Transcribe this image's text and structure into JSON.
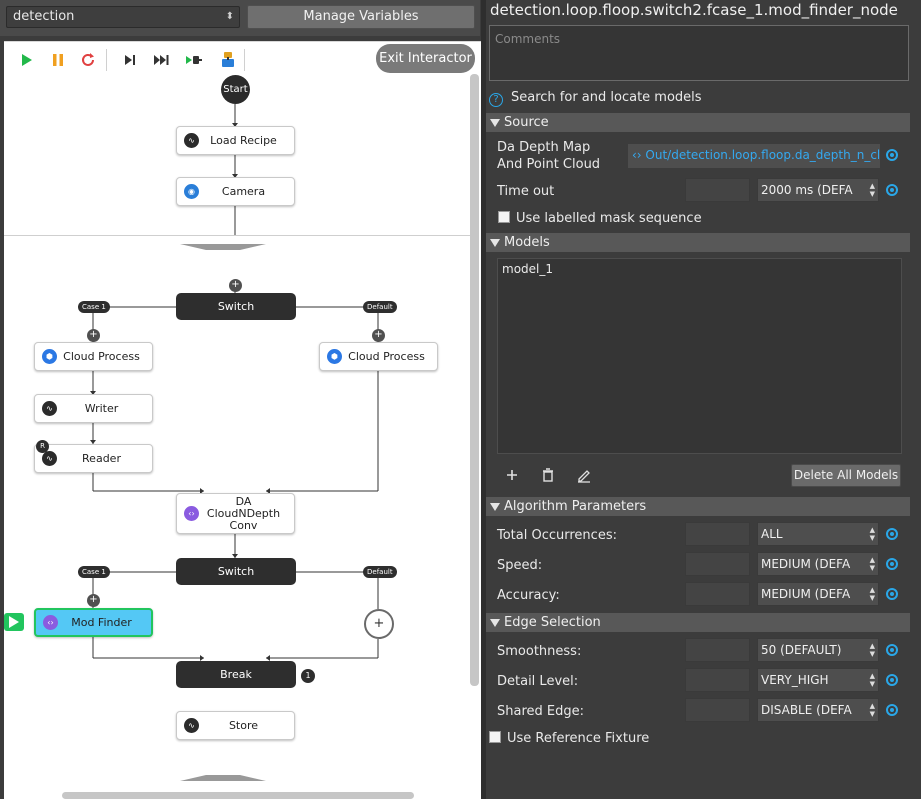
{
  "flow_selector": {
    "value": "detection"
  },
  "toolbar": {
    "manage_variables": "Manage Variables",
    "exit_interactor": "Exit Interactor"
  },
  "flow": {
    "start": "Start",
    "nodes": {
      "load_recipe": "Load Recipe",
      "camera": "Camera",
      "switch1": "Switch",
      "cloud_process_left": "Cloud Process",
      "cloud_process_right": "Cloud Process",
      "writer": "Writer",
      "reader": "Reader",
      "reader_badge": "R",
      "da_cloud_line1": "DA CloudNDepth",
      "da_cloud_line2": "Conv",
      "switch2": "Switch",
      "mod_finder": "Mod Finder",
      "break": "Break",
      "break_badge": "1",
      "store": "Store"
    },
    "tags": {
      "case1_a": "Case 1",
      "default_a": "Default",
      "case1_b": "Case 1",
      "default_b": "Default"
    },
    "plus": "+"
  },
  "panel": {
    "title": "detection.loop.floop.switch2.fcase_1.mod_finder_node",
    "comments_placeholder": "Comments",
    "help_text": "Search for and locate models",
    "sections": {
      "source": "Source",
      "models": "Models",
      "algorithm": "Algorithm Parameters",
      "edge": "Edge Selection"
    },
    "source": {
      "da_label_1": "Da Depth Map",
      "da_label_2": "And Point Cloud",
      "da_value": "Out/detection.loop.floop.da_depth_n_clo",
      "timeout_label": "Time out",
      "timeout_value": "2000 ms (DEFA",
      "labelled_mask": "Use labelled mask sequence"
    },
    "models": {
      "items": [
        "model_1"
      ],
      "delete_all": "Delete All Models"
    },
    "algorithm": {
      "total_occ_label": "Total Occurrences:",
      "total_occ_value": "ALL",
      "speed_label": "Speed:",
      "speed_value": "MEDIUM (DEFA",
      "accuracy_label": "Accuracy:",
      "accuracy_value": "MEDIUM (DEFA"
    },
    "edge": {
      "smoothness_label": "Smoothness:",
      "smoothness_value": "50 (DEFAULT)",
      "detail_label": "Detail Level:",
      "detail_value": "VERY_HIGH",
      "shared_label": "Shared Edge:",
      "shared_value": "DISABLE (DEFA"
    },
    "reference_fixture": "Use Reference Fixture"
  }
}
